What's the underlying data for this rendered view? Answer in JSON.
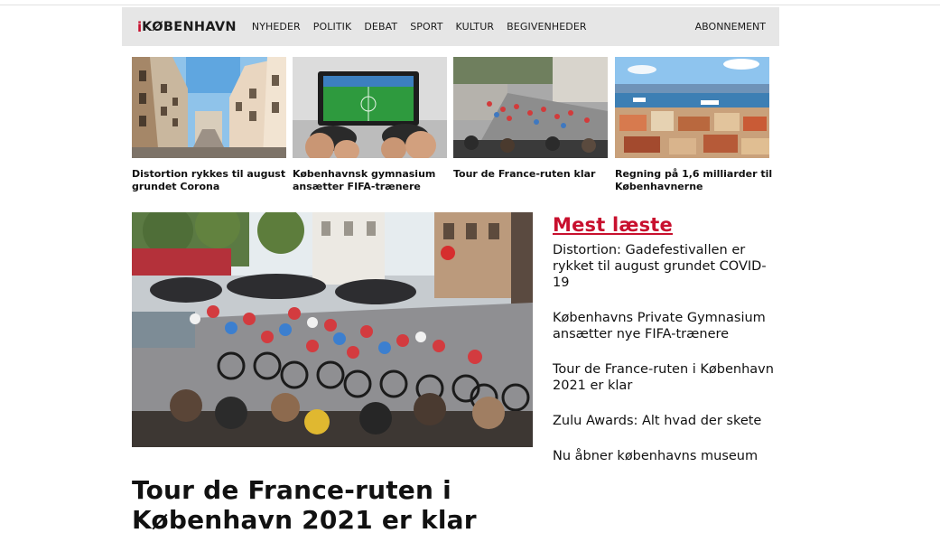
{
  "header": {
    "logo_mark": "i",
    "logo_text": "KØBENHAVN",
    "nav": [
      "NYHEDER",
      "POLITIK",
      "DEBAT",
      "SPORT",
      "KULTUR",
      "BEGIVENHEDER"
    ],
    "subscribe": "ABONNEMENT"
  },
  "teasers": [
    {
      "title": "Distortion rykkes til august grundet Corona",
      "image": "street-buildings-photo"
    },
    {
      "title": "Københavnsk gymnasium ansætter FIFA-trænere",
      "image": "gaming-controllers-photo"
    },
    {
      "title": "Tour de France-ruten klar",
      "image": "cyclists-photo"
    },
    {
      "title": "Regning på 1,6 milliarder til Københavnerne",
      "image": "harbor-city-photo"
    }
  ],
  "main_article": {
    "image": "peloton-race-photo",
    "headline": "Tour de France-ruten i København 2021 er klar"
  },
  "most_read": {
    "title": "Mest læste",
    "items": [
      "Distortion: Gadefestivallen er rykket til august grundet COVID-19",
      "Københavns Private Gymnasium ansætter nye FIFA-trænere",
      "Tour de France-ruten i København 2021 er klar",
      "Zulu Awards: Alt hvad der skete",
      "Nu åbner københavns museum"
    ]
  },
  "colors": {
    "accent": "#c8102e",
    "nav_background": "#e6e6e6",
    "text": "#111111"
  }
}
